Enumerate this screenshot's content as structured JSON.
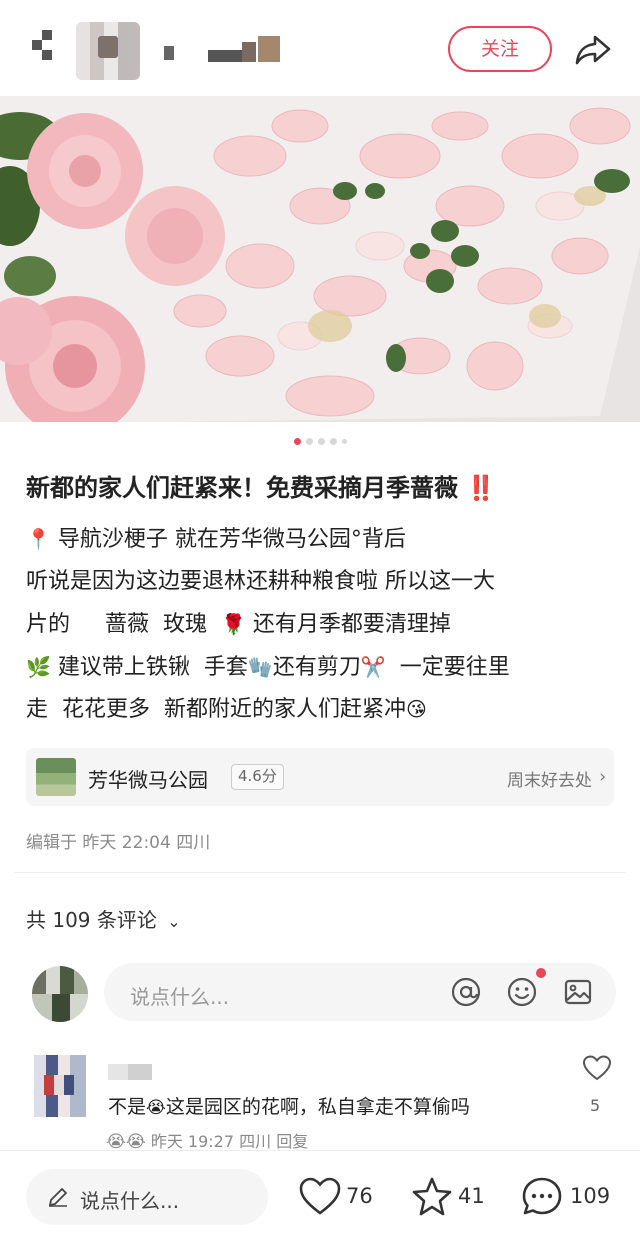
{
  "header": {
    "follow_label": "关注",
    "accent_color": "#e8475a"
  },
  "hero": {
    "slide_count": 5,
    "active_index": 0
  },
  "post": {
    "title": "新都的家人们赶紧来！免费采摘月季蔷薇",
    "title_emoji": "‼️",
    "lines": [
      {
        "emoji_before": "📍",
        "text": "导航沙梗子  就在芳华微马公园",
        "suffix": "°背后"
      },
      {
        "text": "听说是因为这边要退林还耕种粮食啦   所以这一大"
      },
      {
        "text": "片的     蔷薇  玫瑰 ",
        "emoji_after": "🌹",
        "text2": "还有月季都要清理掉"
      },
      {
        "emoji_before": "🌿",
        "text": "建议带上铁锹  手套",
        "emoji_mid": "🧤",
        "text2": "还有剪刀",
        "emoji_mid2": "✂️",
        "text3": "  一定要往里"
      },
      {
        "text": "走  花花更多  新都附近的家人们赶紧冲",
        "emoji_after": "😘"
      }
    ],
    "location": {
      "name": "芳华微马公园",
      "score": "4.6分",
      "tag": "周末好去处"
    },
    "meta": "编辑于  昨天 22:04 四川"
  },
  "comments": {
    "count_label": "共 109 条评论",
    "input_placeholder": "说点什么...",
    "items": [
      {
        "text_prefix": "不是",
        "emoji": "😭",
        "text": "这是园区的花啊，私自拿走不算偷吗",
        "meta_emojis": "😭😭",
        "time": "昨天 19:27 四川",
        "reply_label": "回复",
        "likes": "5"
      }
    ]
  },
  "bottom_bar": {
    "placeholder": "说点什么...",
    "likes": "76",
    "collects": "41",
    "comments": "109"
  }
}
